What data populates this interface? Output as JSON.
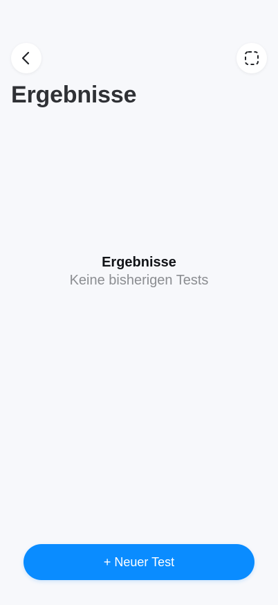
{
  "header": {
    "back_icon": "chevron-left-icon",
    "expand_icon": "dashed-square-icon",
    "title": "Ergebnisse"
  },
  "empty_state": {
    "title": "Ergebnisse",
    "subtitle": "Keine bisherigen Tests"
  },
  "footer": {
    "new_test_label": "+ Neuer Test"
  },
  "colors": {
    "background": "#f7f8fb",
    "primary": "#0a8cff",
    "title_text": "#2f3135",
    "secondary_text": "#8b8d91"
  }
}
